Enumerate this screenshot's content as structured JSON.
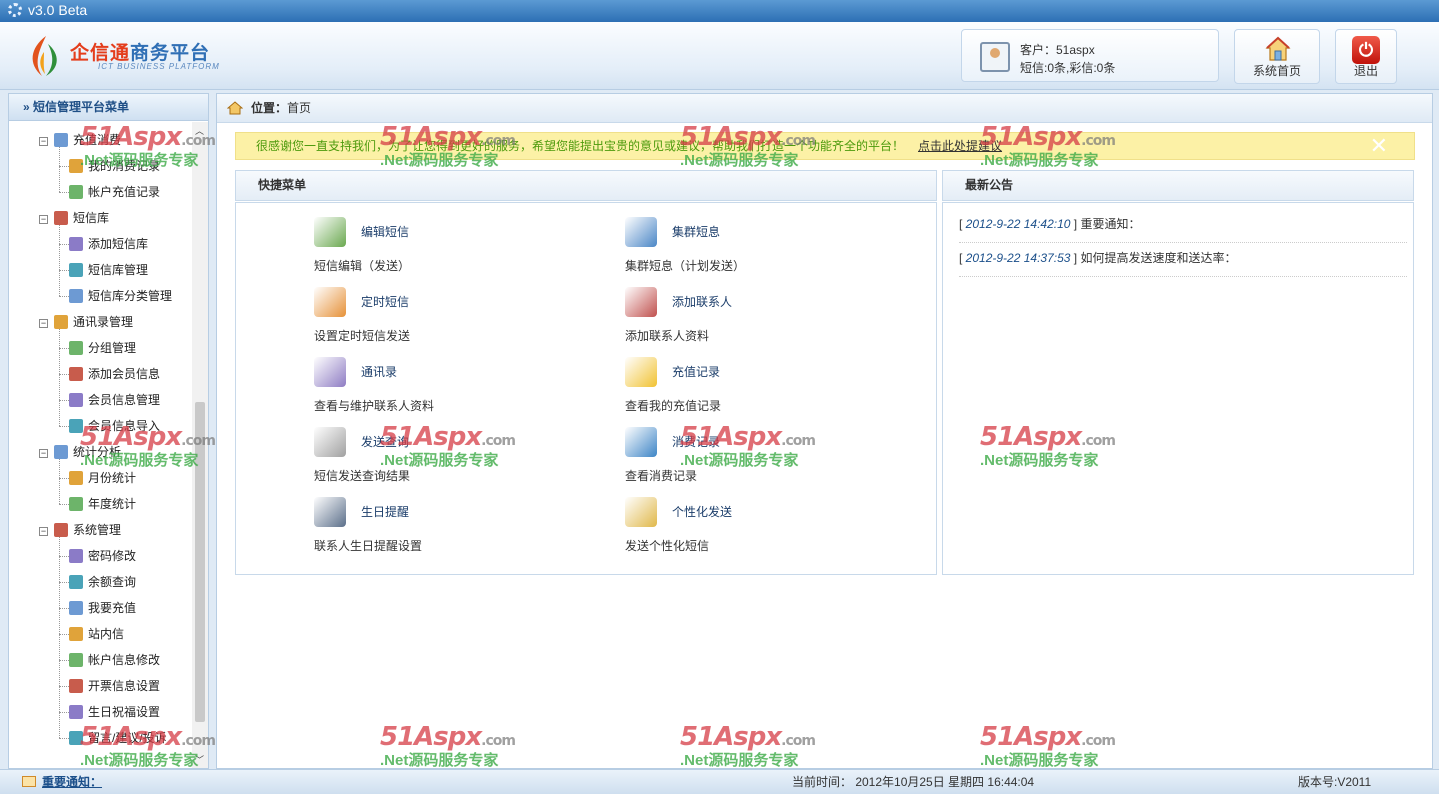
{
  "app": {
    "version": "v3.0  Beta"
  },
  "header": {
    "logo_title_a": "企信通",
    "logo_title_b": "商务平台",
    "logo_sub": "ICT BUSINESS PLATFORM",
    "customer_label": "客户：51aspx",
    "customer_stats": "短信:0条,彩信:0条",
    "home_label": "系统首页",
    "exit_label": "退出"
  },
  "sidebar": {
    "title": "» 短信管理平台菜单",
    "items": [
      {
        "label": "充值消费",
        "group": true,
        "icon": "coins-icon"
      },
      {
        "label": "我的消费记录",
        "icon": "record-icon"
      },
      {
        "label": "帐户充值记录",
        "icon": "recharge-icon"
      },
      {
        "label": "短信库",
        "group": true,
        "icon": "library-icon"
      },
      {
        "label": "添加短信库",
        "icon": "add-icon"
      },
      {
        "label": "短信库管理",
        "icon": "list-icon"
      },
      {
        "label": "短信库分类管理",
        "icon": "category-icon"
      },
      {
        "label": "通讯录管理",
        "group": true,
        "icon": "contacts-icon"
      },
      {
        "label": "分组管理",
        "icon": "group-icon"
      },
      {
        "label": "添加会员信息",
        "icon": "add-member-icon"
      },
      {
        "label": "会员信息管理",
        "icon": "members-icon"
      },
      {
        "label": "会员信息导入",
        "icon": "import-icon"
      },
      {
        "label": "统计分析",
        "group": true,
        "icon": "chart-icon"
      },
      {
        "label": "月份统计",
        "icon": "monthly-chart-icon"
      },
      {
        "label": "年度统计",
        "icon": "yearly-chart-icon"
      },
      {
        "label": "系统管理",
        "group": true,
        "icon": "gear-icon"
      },
      {
        "label": "密码修改",
        "icon": "password-icon"
      },
      {
        "label": "余额查询",
        "icon": "balance-icon"
      },
      {
        "label": "我要充值",
        "icon": "topup-icon"
      },
      {
        "label": "站内信",
        "icon": "inbox-icon"
      },
      {
        "label": "帐户信息修改",
        "icon": "account-edit-icon"
      },
      {
        "label": "开票信息设置",
        "icon": "invoice-icon"
      },
      {
        "label": "生日祝福设置",
        "icon": "birthday-icon"
      },
      {
        "label": "留言/建议/投诉",
        "icon": "feedback-icon"
      }
    ]
  },
  "breadcrumb": {
    "label": "位置：",
    "page": "首页"
  },
  "notice": {
    "text": "很感谢您一直支持我们，为了让您得到更好的服务，希望您能提出宝贵的意见或建议，帮助我们打造一个功能齐全的平台！",
    "link": "点击此处提建议"
  },
  "quick_menu": {
    "title": "快捷菜单",
    "items": [
      {
        "title": "编辑短信",
        "desc": "短信编辑（发送）",
        "icon": "edit-sms-icon"
      },
      {
        "title": "集群短息",
        "desc": "集群短息（计划发送）",
        "icon": "group-sms-icon"
      },
      {
        "title": "定时短信",
        "desc": "设置定时短信发送",
        "icon": "alarm-clock-icon"
      },
      {
        "title": "添加联系人",
        "desc": "添加联系人资料",
        "icon": "add-contact-icon"
      },
      {
        "title": "通讯录",
        "desc": "查看与维护联系人资料",
        "icon": "address-book-icon"
      },
      {
        "title": "充值记录",
        "desc": "查看我的充值记录",
        "icon": "cart-icon"
      },
      {
        "title": "发送查询",
        "desc": "短信发送查询结果",
        "icon": "send-query-icon"
      },
      {
        "title": "消费记录",
        "desc": "查看消费记录",
        "icon": "download-icon"
      },
      {
        "title": "生日提醒",
        "desc": "联系人生日提醒设置",
        "icon": "cash-register-icon"
      },
      {
        "title": "个性化发送",
        "desc": "发送个性化短信",
        "icon": "personalize-icon"
      }
    ]
  },
  "announcements": {
    "title": "最新公告",
    "items": [
      {
        "date": "2012-9-22 14:42:10",
        "title": "重要通知："
      },
      {
        "date": "2012-9-22 14:37:53",
        "title": "如何提高发送速度和送达率："
      }
    ]
  },
  "footer": {
    "notice_link": "重要通知：",
    "time": "当前时间： 2012年10月25日 星期四 16:44:04",
    "version": "版本号:V2011"
  },
  "watermark": {
    "brand": "51Aspx",
    "domain": ".com",
    "tagline": ".Net源码服务专家"
  },
  "colors": {
    "accent": "#2d6fb4",
    "notice_bg": "#fcf1a6",
    "notice_text": "#4c9a0c",
    "watermark_red": "#d63c46",
    "watermark_green": "#3caa46"
  }
}
